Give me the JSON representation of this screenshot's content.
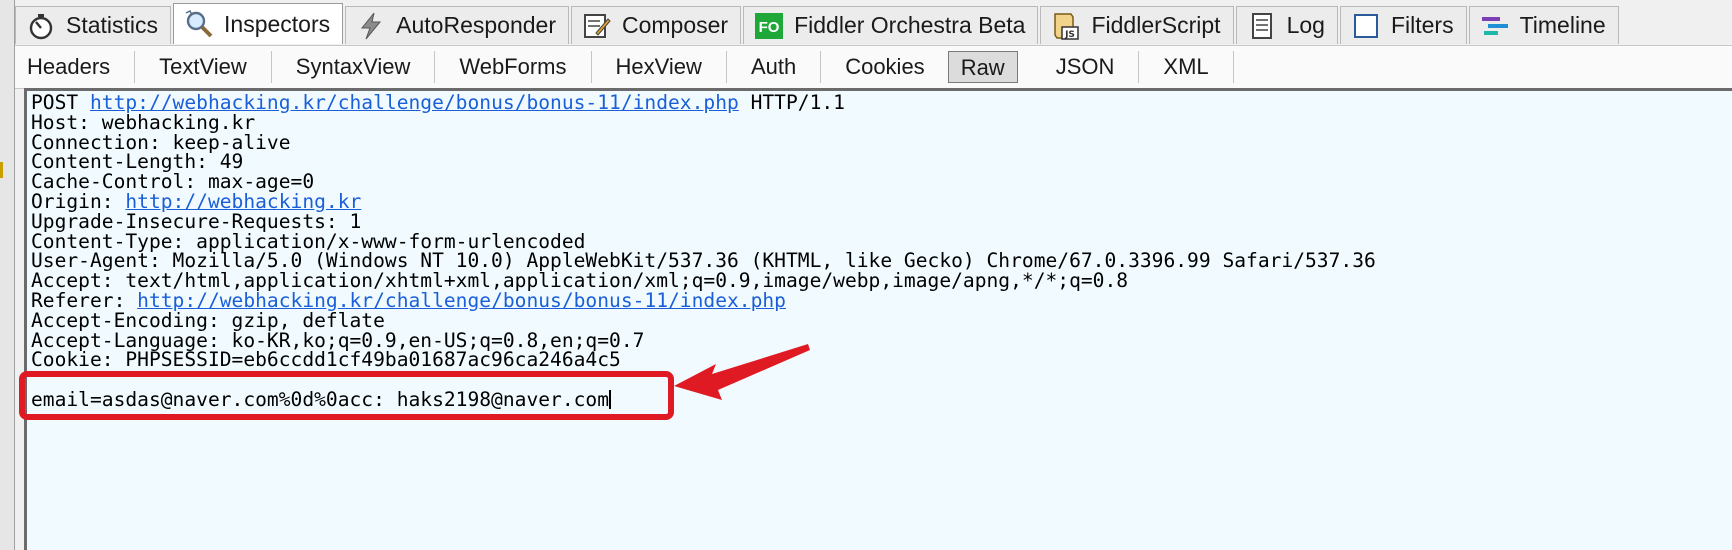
{
  "main_tabs": [
    {
      "label": "Statistics",
      "icon": "stopwatch-icon"
    },
    {
      "label": "Inspectors",
      "icon": "magnifier-icon"
    },
    {
      "label": "AutoResponder",
      "icon": "lightning-icon"
    },
    {
      "label": "Composer",
      "icon": "composer-icon"
    },
    {
      "label": "Fiddler Orchestra Beta",
      "icon": "fo-icon",
      "icon_text": "FO"
    },
    {
      "label": "FiddlerScript",
      "icon": "script-icon",
      "icon_text": "JS"
    },
    {
      "label": "Log",
      "icon": "log-icon"
    },
    {
      "label": "Filters",
      "icon": "checkbox-icon"
    },
    {
      "label": "Timeline",
      "icon": "timeline-icon"
    }
  ],
  "active_main_tab": "Inspectors",
  "sub_tabs": [
    "Headers",
    "TextView",
    "SyntaxView",
    "WebForms",
    "HexView",
    "Auth",
    "Cookies",
    "Raw",
    "JSON",
    "XML"
  ],
  "active_sub_tab": "Raw",
  "request": {
    "method": "POST",
    "url": "http://webhacking.kr/challenge/bonus/bonus-11/index.php",
    "protocol": "HTTP/1.1",
    "headers": [
      {
        "text": "Host: webhacking.kr"
      },
      {
        "text": "Connection: keep-alive"
      },
      {
        "text": "Content-Length: 49"
      },
      {
        "text": "Cache-Control: max-age=0"
      },
      {
        "prefix": "Origin: ",
        "link": "http://webhacking.kr"
      },
      {
        "text": "Upgrade-Insecure-Requests: 1"
      },
      {
        "text": "Content-Type: application/x-www-form-urlencoded"
      },
      {
        "text": "User-Agent: Mozilla/5.0 (Windows NT 10.0) AppleWebKit/537.36 (KHTML, like Gecko) Chrome/67.0.3396.99 Safari/537.36"
      },
      {
        "text": "Accept: text/html,application/xhtml+xml,application/xml;q=0.9,image/webp,image/apng,*/*;q=0.8"
      },
      {
        "prefix": "Referer: ",
        "link": "http://webhacking.kr/challenge/bonus/bonus-11/index.php"
      },
      {
        "text": "Accept-Encoding: gzip, deflate"
      },
      {
        "text": "Accept-Language: ko-KR,ko;q=0.9,en-US;q=0.8,en;q=0.7"
      },
      {
        "text": "Cookie: PHPSESSID=eb6ccdd1cf49ba01687ac96ca246a4c5"
      }
    ],
    "body": "email=asdas@naver.com%0d%0acc: haks2198@naver.com"
  },
  "colors": {
    "link": "#1a5fd8",
    "annotation": "#e01a22",
    "panel_bg": "#f1fbff",
    "fo_icon": "#1fa83a"
  }
}
